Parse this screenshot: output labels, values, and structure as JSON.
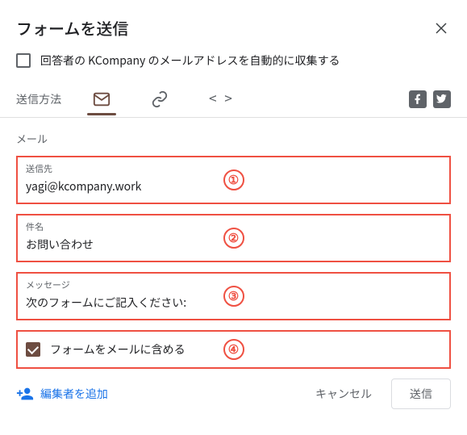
{
  "header": {
    "title": "フォームを送信"
  },
  "collect": {
    "label": "回答者の KCompany のメールアドレスを自動的に収集する",
    "checked": false
  },
  "method": {
    "label": "送信方法",
    "tabs": [
      "email",
      "link",
      "embed"
    ],
    "active": "email"
  },
  "section": {
    "label": "メール"
  },
  "fields": {
    "to": {
      "label": "送信先",
      "value": "yagi@kcompany.work"
    },
    "subject": {
      "label": "件名",
      "value": "お問い合わせ"
    },
    "message": {
      "label": "メッセージ",
      "value": "次のフォームにご記入ください:"
    }
  },
  "include": {
    "label": "フォームをメールに含める",
    "checked": true
  },
  "annotations": [
    "①",
    "②",
    "③",
    "④"
  ],
  "footer": {
    "add_editor": "編集者を追加",
    "cancel": "キャンセル",
    "send": "送信"
  }
}
